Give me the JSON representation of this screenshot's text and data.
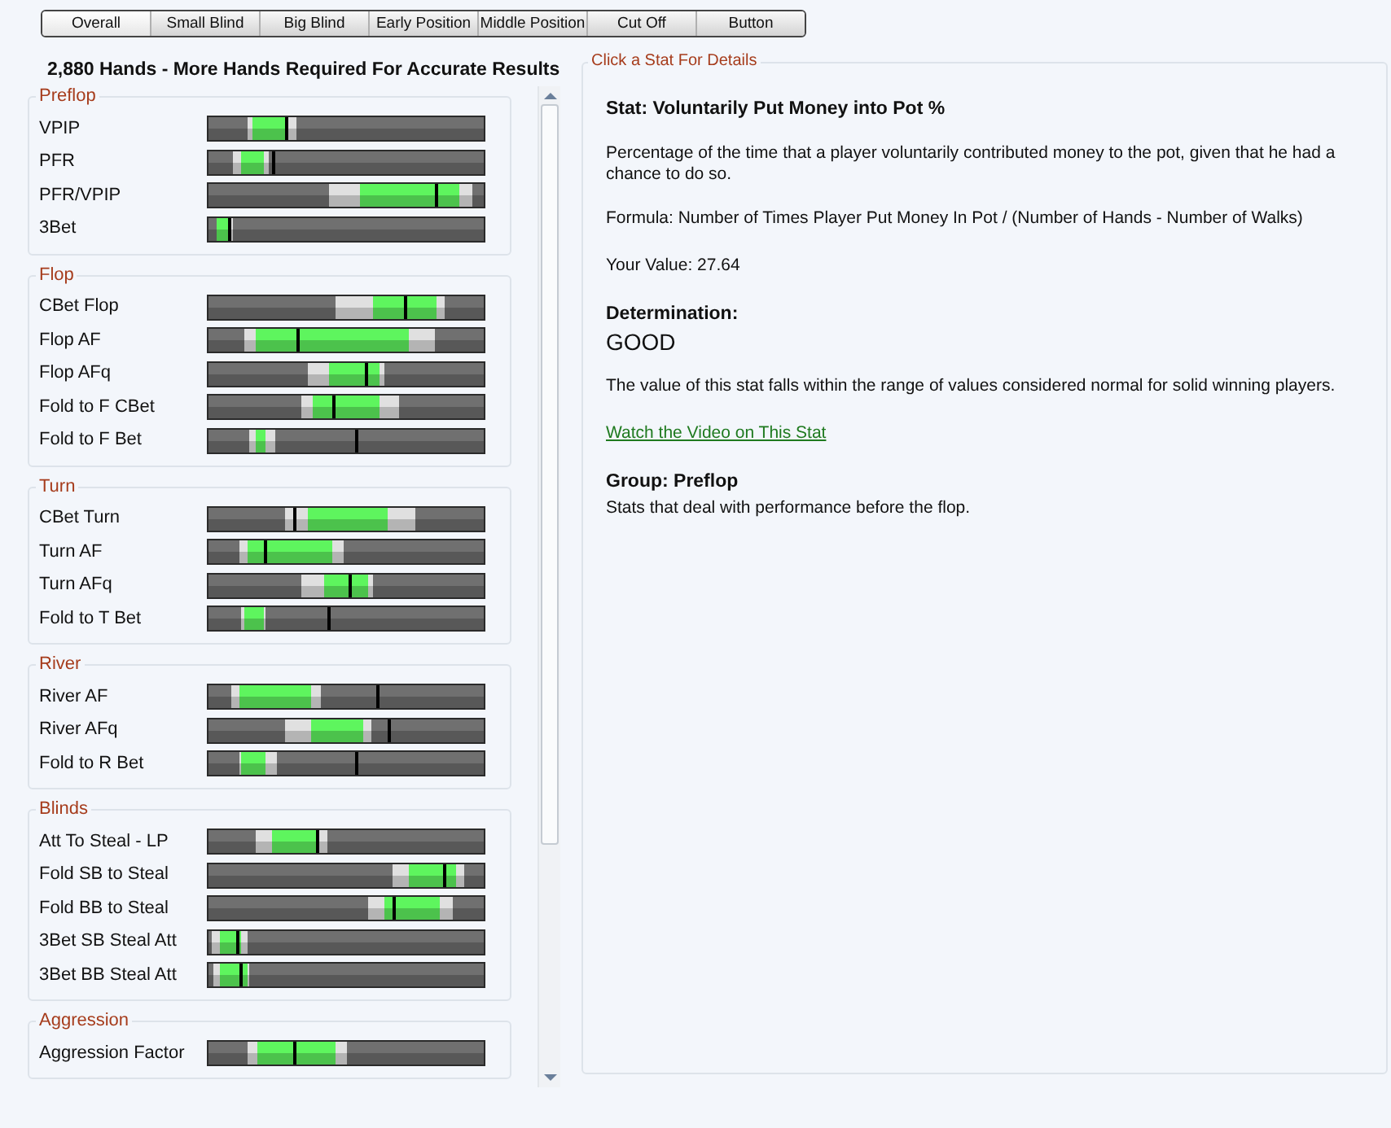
{
  "tabs": [
    {
      "label": "Overall",
      "selected": true
    },
    {
      "label": "Small Blind",
      "selected": false
    },
    {
      "label": "Big Blind",
      "selected": false
    },
    {
      "label": "Early Position",
      "selected": false
    },
    {
      "label": "Middle Position",
      "selected": false
    },
    {
      "label": "Cut Off",
      "selected": false
    },
    {
      "label": "Button",
      "selected": false
    }
  ],
  "heading": "2,880 Hands - More Hands Required For Accurate Results",
  "groups": [
    {
      "title": "Preflop",
      "stats": [
        {
          "label": "VPIP",
          "level": 0.28,
          "ok": [
            {
              "level": 0.14
            },
            {
              "level": 0.32
            }
          ],
          "good": [
            {
              "level": 0.16
            },
            {
              "level": 0.28
            }
          ]
        },
        {
          "label": "PFR",
          "level": 0.23,
          "ok": [
            {
              "level": 0.09
            },
            {
              "level": 0.22
            }
          ],
          "good": [
            {
              "level": 0.12
            },
            {
              "level": 0.2
            }
          ]
        },
        {
          "label": "PFR/VPIP",
          "level": 0.82,
          "ok": [
            {
              "level": 0.44
            },
            {
              "level": 0.96
            }
          ],
          "good": [
            {
              "level": 0.55
            },
            {
              "level": 0.91
            }
          ]
        },
        {
          "label": "3Bet",
          "level": 0.07,
          "ok": [
            {
              "level": 0.03
            },
            {
              "level": 0.09
            }
          ],
          "good": [
            {
              "level": 0.03
            },
            {
              "level": 0.07
            }
          ]
        }
      ]
    },
    {
      "title": "Flop",
      "stats": [
        {
          "label": "CBet Flop",
          "level": 0.71,
          "ok": [
            {
              "level": 0.46
            },
            {
              "level": 0.86
            }
          ],
          "good": [
            {
              "level": 0.6
            },
            {
              "level": 0.83
            }
          ]
        },
        {
          "label": "Flop AF",
          "level": 0.32,
          "ok": [
            {
              "level": 0.13
            },
            {
              "level": 0.82
            }
          ],
          "good": [
            {
              "level": 0.17
            },
            {
              "level": 0.73
            }
          ]
        },
        {
          "label": "Flop AFq",
          "level": 0.57,
          "ok": [
            {
              "level": 0.36
            },
            {
              "level": 0.64
            }
          ],
          "good": [
            {
              "level": 0.44
            },
            {
              "level": 0.62
            }
          ]
        },
        {
          "label": "Fold to F CBet",
          "level": 0.45,
          "ok": [
            {
              "level": 0.34
            },
            {
              "level": 0.69
            }
          ],
          "good": [
            {
              "level": 0.38
            },
            {
              "level": 0.62
            }
          ]
        },
        {
          "label": "Fold to F Bet",
          "level": 0.53,
          "ok": [
            {
              "level": 0.15
            },
            {
              "level": 0.24
            }
          ],
          "good": [
            {
              "level": 0.17
            },
            {
              "level": 0.21
            }
          ]
        }
      ]
    },
    {
      "title": "Turn",
      "stats": [
        {
          "label": "CBet Turn",
          "level": 0.31,
          "ok": [
            {
              "level": 0.28
            },
            {
              "level": 0.75
            }
          ],
          "good": [
            {
              "level": 0.36
            },
            {
              "level": 0.65
            }
          ]
        },
        {
          "label": "Turn AF",
          "level": 0.2,
          "ok": [
            {
              "level": 0.11
            },
            {
              "level": 0.49
            }
          ],
          "good": [
            {
              "level": 0.14
            },
            {
              "level": 0.45
            }
          ]
        },
        {
          "label": "Turn AFq",
          "level": 0.51,
          "ok": [
            {
              "level": 0.34
            },
            {
              "level": 0.6
            }
          ],
          "good": [
            {
              "level": 0.42
            },
            {
              "level": 0.58
            }
          ]
        },
        {
          "label": "Fold to T Bet",
          "level": 0.43,
          "ok": [
            {
              "level": 0.12
            },
            {
              "level": 0.21
            }
          ],
          "good": [
            {
              "level": 0.13
            },
            {
              "level": 0.2
            }
          ]
        }
      ]
    },
    {
      "title": "River",
      "stats": [
        {
          "label": "River AF",
          "level": 0.61,
          "ok": [
            {
              "level": 0.08
            },
            {
              "level": 0.41
            }
          ],
          "good": [
            {
              "level": 0.11
            },
            {
              "level": 0.37
            }
          ]
        },
        {
          "label": "River AFq",
          "level": 0.65,
          "ok": [
            {
              "level": 0.28
            },
            {
              "level": 0.59
            }
          ],
          "good": [
            {
              "level": 0.37
            },
            {
              "level": 0.56
            }
          ]
        },
        {
          "label": "Fold to R Bet",
          "level": 0.53,
          "ok": [
            {
              "level": 0.11
            },
            {
              "level": 0.25
            }
          ],
          "good": [
            {
              "level": 0.12
            },
            {
              "level": 0.21
            }
          ]
        }
      ]
    },
    {
      "title": "Blinds",
      "stats": [
        {
          "label": "Att To Steal - LP",
          "level": 0.39,
          "ok": [
            {
              "level": 0.17
            },
            {
              "level": 0.43
            }
          ],
          "good": [
            {
              "level": 0.23
            },
            {
              "level": 0.39
            }
          ]
        },
        {
          "label": "Fold SB to Steal",
          "level": 0.85,
          "ok": [
            {
              "level": 0.67
            },
            {
              "level": 0.93
            }
          ],
          "good": [
            {
              "level": 0.73
            },
            {
              "level": 0.9
            }
          ]
        },
        {
          "label": "Fold BB to Steal",
          "level": 0.67,
          "ok": [
            {
              "level": 0.58
            },
            {
              "level": 0.89
            }
          ],
          "good": [
            {
              "level": 0.64
            },
            {
              "level": 0.84
            }
          ]
        },
        {
          "label": "3Bet SB Steal Att",
          "level": 0.1,
          "ok": [
            {
              "level": 0.01
            },
            {
              "level": 0.14
            }
          ],
          "good": [
            {
              "level": 0.04
            },
            {
              "level": 0.12
            }
          ]
        },
        {
          "label": "3Bet BB Steal Att",
          "level": 0.11,
          "ok": [
            {
              "level": 0.02
            },
            {
              "level": 0.15
            }
          ],
          "good": [
            {
              "level": 0.04
            },
            {
              "level": 0.14
            }
          ]
        }
      ]
    },
    {
      "title": "Aggression",
      "stats": [
        {
          "label": "Aggression Factor",
          "level": 0.31,
          "ok": [
            {
              "level": 0.14
            },
            {
              "level": 0.5
            }
          ],
          "good": [
            {
              "level": 0.18
            },
            {
              "level": 0.46
            }
          ]
        }
      ]
    }
  ],
  "details": {
    "legend": "Click a Stat For Details",
    "stat": "Stat: Voluntarily Put Money into Pot %",
    "description": "Percentage of the time that a player voluntarily contributed money to the pot, given that he had a chance to do so.",
    "formula": "Formula: Number of Times Player Put Money In Pot / (Number of Hands - Number of Walks)",
    "value": "Your Value: 27.64",
    "determination_label": "Determination:",
    "determination": "GOOD",
    "verdict": "The value of this stat falls within the range of values considered normal for solid winning players.",
    "link": "Watch the Video on This Stat",
    "group_label": "Group: Preflop",
    "group_description": "Stats that deal with performance before the flop."
  }
}
